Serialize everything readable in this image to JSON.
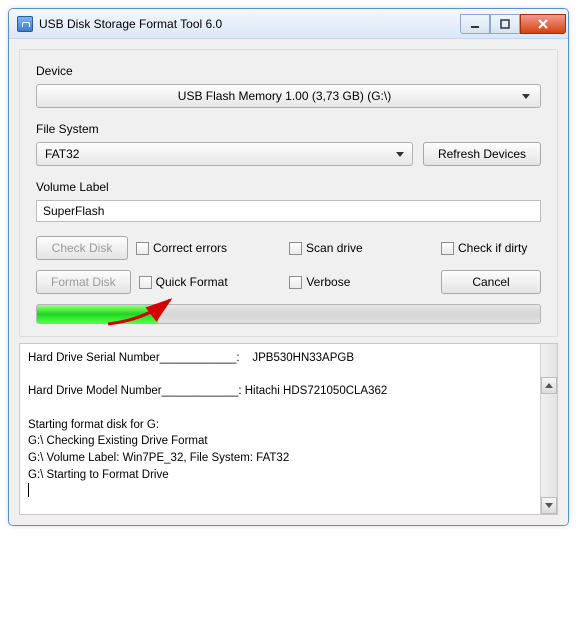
{
  "window": {
    "title": "USB Disk Storage Format Tool 6.0"
  },
  "device": {
    "label": "Device",
    "selected": "USB Flash Memory  1.00 (3,73 GB) (G:\\)"
  },
  "filesystem": {
    "label": "File System",
    "selected": "FAT32",
    "refresh_btn": "Refresh Devices"
  },
  "volume": {
    "label": "Volume Label",
    "value": "SuperFlash"
  },
  "buttons": {
    "check_disk": "Check Disk",
    "format_disk": "Format Disk",
    "cancel": "Cancel"
  },
  "checks": {
    "correct_errors": "Correct errors",
    "scan_drive": "Scan drive",
    "check_if_dirty": "Check if dirty",
    "quick_format": "Quick Format",
    "verbose": "Verbose"
  },
  "progress": {
    "percent": 24
  },
  "log": {
    "text": "Hard Drive Serial Number____________:    JPB530HN33APGB\n\nHard Drive Model Number____________: Hitachi HDS721050CLA362\n\nStarting format disk for G:\nG:\\ Checking Existing Drive Format\nG:\\ Volume Label: Win7PE_32, File System: FAT32\nG:\\ Starting to Format Drive"
  }
}
